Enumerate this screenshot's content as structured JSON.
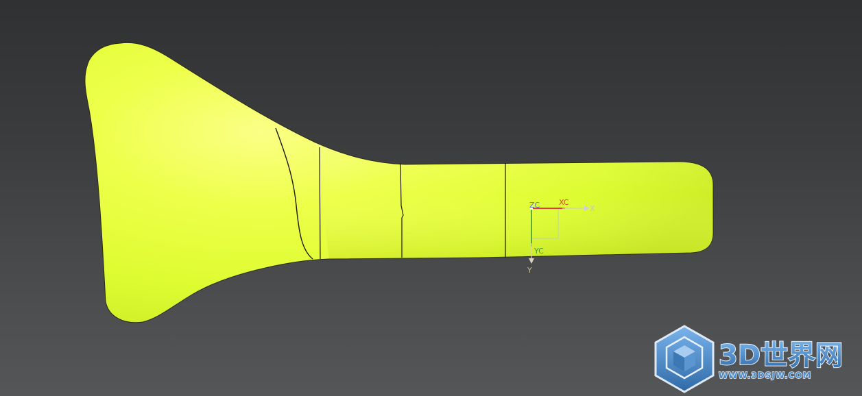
{
  "viewport": {
    "background_top": "#303132",
    "background_bottom": "#555658"
  },
  "model": {
    "color": "#e6ff3a",
    "edge_color": "#1a1a10"
  },
  "csys": {
    "zc_label": "ZC",
    "xc_label": "XC",
    "x_label": "X",
    "yc_label": "YC",
    "y_label": "Y",
    "colors": {
      "zc": "#5a78c8",
      "xc": "#e23b3b",
      "yc": "#3c9a3c",
      "x": "#c8c8c8",
      "y": "#c8b48c"
    }
  },
  "watermark": {
    "title": "3D世界网",
    "url": "WWW.3DSJW.COM",
    "logo_icon": "cube-icon",
    "color": "#4a8ac8"
  }
}
